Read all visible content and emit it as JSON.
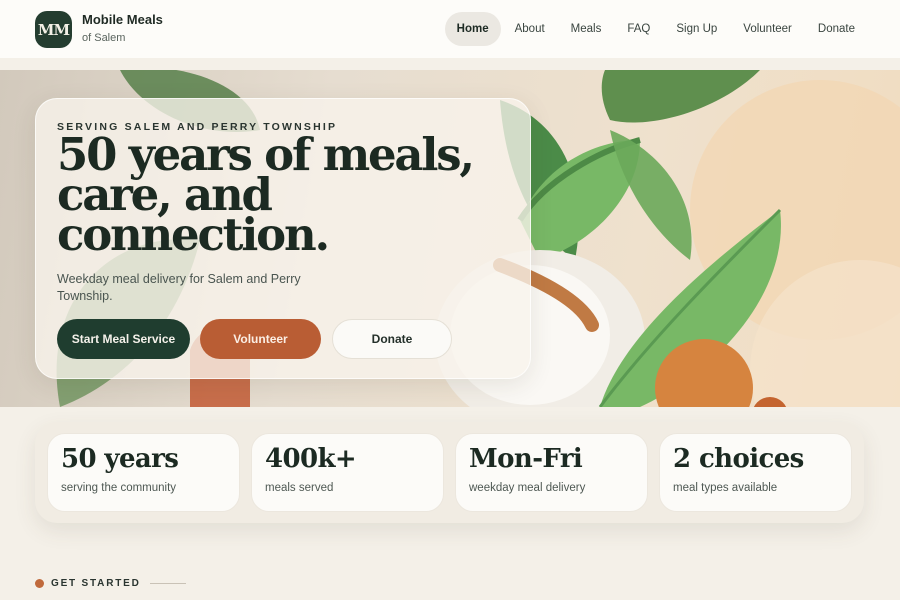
{
  "brand": {
    "initials": "MM",
    "name": "Mobile Meals",
    "subtitle": "of Salem"
  },
  "nav": {
    "items": [
      {
        "label": "Home",
        "active": true
      },
      {
        "label": "About",
        "active": false
      },
      {
        "label": "Meals",
        "active": false
      },
      {
        "label": "FAQ",
        "active": false
      },
      {
        "label": "Sign Up",
        "active": false
      },
      {
        "label": "Volunteer",
        "active": false
      },
      {
        "label": "Donate",
        "active": false
      }
    ]
  },
  "hero": {
    "eyebrow": "SERVING SALEM AND PERRY TOWNSHIP",
    "title": "50 years of meals, care, and connection.",
    "subtitle": "Weekday meal delivery for Salem and Perry Township.",
    "buttons": {
      "primary": "Start Meal Service",
      "volunteer": "Volunteer",
      "donate": "Donate"
    }
  },
  "stats": [
    {
      "value": "50 years",
      "label": "serving the community"
    },
    {
      "value": "400k+",
      "label": "meals served"
    },
    {
      "value": "Mon-Fri",
      "label": "weekday meal delivery"
    },
    {
      "value": "2 choices",
      "label": "meal types available"
    }
  ],
  "get_started": {
    "label": "GET STARTED"
  },
  "colors": {
    "brand_dark": "#1f3d2f",
    "accent_orange": "#b95d34",
    "background": "#f4f0e8",
    "leaf_green": "#7ab766"
  }
}
